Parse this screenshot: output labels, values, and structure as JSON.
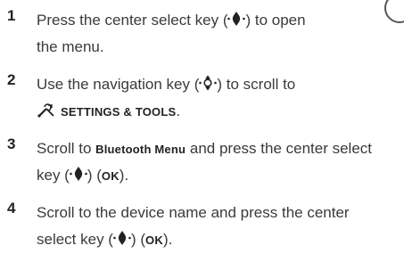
{
  "steps": [
    {
      "num": "1",
      "l1a": "Press the center select key (",
      "l1b": ") to open",
      "l2": "the menu."
    },
    {
      "num": "2",
      "l1a": "Use the navigation key (",
      "l1b": ") to scroll to",
      "l2_menu": "SETTINGS & TOOLS",
      "l2_end": "."
    },
    {
      "num": "3",
      "l1a": "Scroll to ",
      "l1_menu": "Bluetooth Menu",
      "l1b": " and press the center select",
      "l2a": "key (",
      "l2b": ") (",
      "l2_ok": "OK",
      "l2c": ")."
    },
    {
      "num": "4",
      "l1": "Scroll to the device name and press the center",
      "l2a": "select key (",
      "l2b": ") (",
      "l2_ok": "OK",
      "l2c": ")."
    }
  ],
  "icons": {
    "select_key": "center-select-key-icon",
    "nav_key": "navigation-key-icon",
    "settings": "settings-tools-icon"
  }
}
